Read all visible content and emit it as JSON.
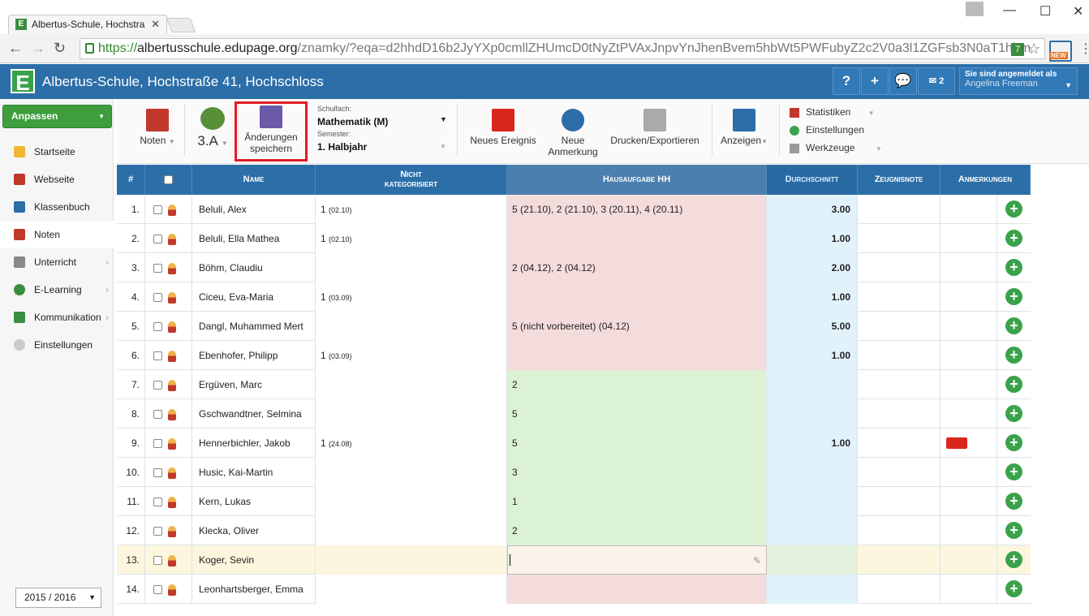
{
  "browser": {
    "tab_title": "Albertus-Schule, Hochstra",
    "url_scheme": "https://",
    "url_host": "albertusschule.edupage.org",
    "url_path": "/znamky/?eqa=d2hhdD16b2JyYXp0cmllZHUmcD0tNyZtPVAxJnpvYnJhenBvem5hbWt5PWFubyZ2c2V0a3l1ZGFsb3N0aT1hbm",
    "ext_badge": "NEW"
  },
  "header": {
    "logo": "E",
    "school_name": "Albertus-Schule, Hochstraße 41, Hochschloss",
    "help": "?",
    "add": "+",
    "msg_count": "2",
    "login_label": "Sie sind angemeldet als",
    "user_name": "Angelina Freeman"
  },
  "sidebar": {
    "customize": "Anpassen",
    "items": [
      {
        "label": "Startseite"
      },
      {
        "label": "Webseite"
      },
      {
        "label": "Klassenbuch"
      },
      {
        "label": "Noten"
      },
      {
        "label": "Unterricht"
      },
      {
        "label": "E-Learning"
      },
      {
        "label": "Kommunikation"
      },
      {
        "label": "Einstellungen"
      }
    ],
    "year": "2015 / 2016"
  },
  "toolbar": {
    "grades": "Noten",
    "class": "3.A",
    "save1": "Änderungen",
    "save2": "speichern",
    "subject_label": "Schulfach:",
    "subject_value": "Mathematik (M)",
    "semester_label": "Semester:",
    "semester_value": "1. Halbjahr",
    "new_event": "Neues Ereignis",
    "new_note1": "Neue",
    "new_note2": "Anmerkung",
    "print": "Drucken/Exportieren",
    "show": "Anzeigen",
    "stats": "Statistiken",
    "settings": "Einstellungen",
    "tools": "Werkzeuge"
  },
  "columns": {
    "num": "#",
    "name": "Name",
    "uncat1": "Nicht",
    "uncat2": "kategorisiert",
    "homework": "Hausaufgabe HH",
    "avg": "Durchschnitt",
    "report": "Zeugnisnote",
    "notes": "Anmerkungen"
  },
  "rows": [
    {
      "n": "1.",
      "name": "Beluli, Alex",
      "uncat": "1",
      "uncat_date": "(02.10)",
      "hw": "5  (21.10), 2  (21.10), 3  (20.11), 4  (20.11)",
      "avg": "3.00"
    },
    {
      "n": "2.",
      "name": "Beluli, Ella Mathea",
      "uncat": "1",
      "uncat_date": "(02.10)",
      "hw": "",
      "avg": "1.00"
    },
    {
      "n": "3.",
      "name": "Böhm, Claudiu",
      "uncat": "",
      "uncat_date": "",
      "hw": "2 (04.12), 2 (04.12)",
      "avg": "2.00"
    },
    {
      "n": "4.",
      "name": "Ciceu, Eva-Maria",
      "uncat": "1",
      "uncat_date": "(03.09)",
      "hw": "",
      "avg": "1.00"
    },
    {
      "n": "5.",
      "name": "Dangl, Muhammed Mert",
      "uncat": "",
      "uncat_date": "",
      "hw": "5 (nicht vorbereitet) (04.12)",
      "avg": "5.00"
    },
    {
      "n": "6.",
      "name": "Ebenhofer, Philipp",
      "uncat": "1",
      "uncat_date": "(03.09)",
      "hw": "",
      "avg": "1.00"
    },
    {
      "n": "7.",
      "name": "Ergüven, Marc",
      "uncat": "",
      "uncat_date": "",
      "hw": "2",
      "avg": ""
    },
    {
      "n": "8.",
      "name": "Gschwandtner, Selmina",
      "uncat": "",
      "uncat_date": "",
      "hw": "5",
      "avg": ""
    },
    {
      "n": "9.",
      "name": "Hennerbichler, Jakob",
      "uncat": "1",
      "uncat_date": "(24.08)",
      "hw": "5",
      "avg": "1.00"
    },
    {
      "n": "10.",
      "name": "Husic, Kai-Martin",
      "uncat": "",
      "uncat_date": "",
      "hw": "3",
      "avg": ""
    },
    {
      "n": "11.",
      "name": "Kern, Lukas",
      "uncat": "",
      "uncat_date": "",
      "hw": "1",
      "avg": ""
    },
    {
      "n": "12.",
      "name": "Klecka, Oliver",
      "uncat": "",
      "uncat_date": "",
      "hw": "2",
      "avg": ""
    },
    {
      "n": "13.",
      "name": "Koger, Sevin",
      "uncat": "",
      "uncat_date": "",
      "hw": "",
      "avg": ""
    },
    {
      "n": "14.",
      "name": "Leonhartsberger, Emma",
      "uncat": "",
      "uncat_date": "",
      "hw": "",
      "avg": ""
    }
  ],
  "colors": {
    "header_blue": "#2c6ea8",
    "hw_red": "#f5dcdc",
    "hw_green": "#dcf2d4",
    "avg_blue": "#e2f2fb",
    "edit_row": "#fdf6de",
    "plus_green": "#3aa24a"
  }
}
